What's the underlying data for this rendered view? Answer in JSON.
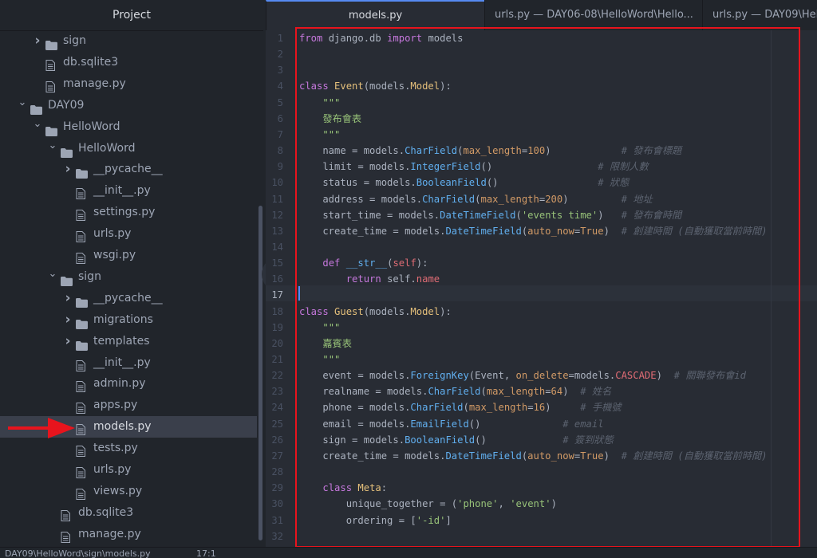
{
  "sidebar": {
    "title": "Project",
    "rows": [
      {
        "label": "sign",
        "type": "folder",
        "level": 1,
        "chevron": "right"
      },
      {
        "label": "db.sqlite3",
        "type": "file",
        "level": 1
      },
      {
        "label": "manage.py",
        "type": "file",
        "level": 1
      },
      {
        "label": "DAY09",
        "type": "folder",
        "level": 0,
        "chevron": "down"
      },
      {
        "label": "HelloWord",
        "type": "folder",
        "level": 1,
        "chevron": "down"
      },
      {
        "label": "HelloWord",
        "type": "folder",
        "level": 2,
        "chevron": "down"
      },
      {
        "label": "__pycache__",
        "type": "folder",
        "level": 3,
        "chevron": "right"
      },
      {
        "label": "__init__.py",
        "type": "file",
        "level": 3
      },
      {
        "label": "settings.py",
        "type": "file",
        "level": 3
      },
      {
        "label": "urls.py",
        "type": "file",
        "level": 3
      },
      {
        "label": "wsgi.py",
        "type": "file",
        "level": 3
      },
      {
        "label": "sign",
        "type": "folder",
        "level": 2,
        "chevron": "down"
      },
      {
        "label": "__pycache__",
        "type": "folder",
        "level": 3,
        "chevron": "right"
      },
      {
        "label": "migrations",
        "type": "folder",
        "level": 3,
        "chevron": "right"
      },
      {
        "label": "templates",
        "type": "folder",
        "level": 3,
        "chevron": "right"
      },
      {
        "label": "__init__.py",
        "type": "file",
        "level": 3
      },
      {
        "label": "admin.py",
        "type": "file",
        "level": 3
      },
      {
        "label": "apps.py",
        "type": "file",
        "level": 3
      },
      {
        "label": "models.py",
        "type": "file",
        "level": 3,
        "selected": true
      },
      {
        "label": "tests.py",
        "type": "file",
        "level": 3
      },
      {
        "label": "urls.py",
        "type": "file",
        "level": 3
      },
      {
        "label": "views.py",
        "type": "file",
        "level": 3
      },
      {
        "label": "db.sqlite3",
        "type": "file",
        "level": 2
      },
      {
        "label": "manage.py",
        "type": "file",
        "level": 2
      }
    ]
  },
  "tabs": [
    {
      "label": "models.py",
      "active": true
    },
    {
      "label": "urls.py — DAY06-08\\HelloWord\\Hello...",
      "active": false
    },
    {
      "label": "urls.py — DAY09\\HelloWord\\He",
      "active": false
    }
  ],
  "editor": {
    "cursor_line": 17,
    "lines": [
      [
        [
          "kw",
          "from"
        ],
        [
          "plain",
          " django.db "
        ],
        [
          "kw",
          "import"
        ],
        [
          "plain",
          " models"
        ]
      ],
      [],
      [],
      [
        [
          "kw",
          "class"
        ],
        [
          "plain",
          " "
        ],
        [
          "cls",
          "Event"
        ],
        [
          "plain",
          "(models."
        ],
        [
          "cls",
          "Model"
        ],
        [
          "plain",
          "):"
        ]
      ],
      [
        [
          "plain",
          "    "
        ],
        [
          "str",
          "\"\"\""
        ]
      ],
      [
        [
          "plain",
          "    "
        ],
        [
          "str",
          "發布會表"
        ]
      ],
      [
        [
          "plain",
          "    "
        ],
        [
          "str",
          "\"\"\""
        ]
      ],
      [
        [
          "plain",
          "    name = models."
        ],
        [
          "fn",
          "CharField"
        ],
        [
          "plain",
          "("
        ],
        [
          "arg",
          "max_length"
        ],
        [
          "plain",
          "="
        ],
        [
          "num",
          "100"
        ],
        [
          "plain",
          ")            "
        ],
        [
          "cmt",
          "# 發布會標題"
        ]
      ],
      [
        [
          "plain",
          "    limit = models."
        ],
        [
          "fn",
          "IntegerField"
        ],
        [
          "plain",
          "()                  "
        ],
        [
          "cmt",
          "# 限制人數"
        ]
      ],
      [
        [
          "plain",
          "    status = models."
        ],
        [
          "fn",
          "BooleanField"
        ],
        [
          "plain",
          "()                 "
        ],
        [
          "cmt",
          "# 狀態"
        ]
      ],
      [
        [
          "plain",
          "    address = models."
        ],
        [
          "fn",
          "CharField"
        ],
        [
          "plain",
          "("
        ],
        [
          "arg",
          "max_length"
        ],
        [
          "plain",
          "="
        ],
        [
          "num",
          "200"
        ],
        [
          "plain",
          ")         "
        ],
        [
          "cmt",
          "# 地址"
        ]
      ],
      [
        [
          "plain",
          "    start_time = models."
        ],
        [
          "fn",
          "DateTimeField"
        ],
        [
          "plain",
          "("
        ],
        [
          "str",
          "'events time'"
        ],
        [
          "plain",
          ")   "
        ],
        [
          "cmt",
          "# 發布會時間"
        ]
      ],
      [
        [
          "plain",
          "    create_time = models."
        ],
        [
          "fn",
          "DateTimeField"
        ],
        [
          "plain",
          "("
        ],
        [
          "arg",
          "auto_now"
        ],
        [
          "plain",
          "="
        ],
        [
          "num",
          "True"
        ],
        [
          "plain",
          ")  "
        ],
        [
          "cmt",
          "# 創建時間 (自動獲取當前時間)"
        ]
      ],
      [],
      [
        [
          "plain",
          "    "
        ],
        [
          "kw",
          "def"
        ],
        [
          "plain",
          " "
        ],
        [
          "fn",
          "__str__"
        ],
        [
          "plain",
          "("
        ],
        [
          "prop",
          "self"
        ],
        [
          "plain",
          "):"
        ]
      ],
      [
        [
          "plain",
          "        "
        ],
        [
          "kw",
          "return"
        ],
        [
          "plain",
          " self."
        ],
        [
          "prop",
          "name"
        ]
      ],
      [],
      [
        [
          "kw",
          "class"
        ],
        [
          "plain",
          " "
        ],
        [
          "cls",
          "Guest"
        ],
        [
          "plain",
          "(models."
        ],
        [
          "cls",
          "Model"
        ],
        [
          "plain",
          "):"
        ]
      ],
      [
        [
          "plain",
          "    "
        ],
        [
          "str",
          "\"\"\""
        ]
      ],
      [
        [
          "plain",
          "    "
        ],
        [
          "str",
          "嘉賓表"
        ]
      ],
      [
        [
          "plain",
          "    "
        ],
        [
          "str",
          "\"\"\""
        ]
      ],
      [
        [
          "plain",
          "    event = models."
        ],
        [
          "fn",
          "ForeignKey"
        ],
        [
          "plain",
          "(Event, "
        ],
        [
          "arg",
          "on_delete"
        ],
        [
          "plain",
          "=models."
        ],
        [
          "prop",
          "CASCADE"
        ],
        [
          "plain",
          ")  "
        ],
        [
          "cmt",
          "# 關聯發布會id"
        ]
      ],
      [
        [
          "plain",
          "    realname = models."
        ],
        [
          "fn",
          "CharField"
        ],
        [
          "plain",
          "("
        ],
        [
          "arg",
          "max_length"
        ],
        [
          "plain",
          "="
        ],
        [
          "num",
          "64"
        ],
        [
          "plain",
          ")  "
        ],
        [
          "cmt",
          "# 姓名"
        ]
      ],
      [
        [
          "plain",
          "    phone = models."
        ],
        [
          "fn",
          "CharField"
        ],
        [
          "plain",
          "("
        ],
        [
          "arg",
          "max_length"
        ],
        [
          "plain",
          "="
        ],
        [
          "num",
          "16"
        ],
        [
          "plain",
          ")     "
        ],
        [
          "cmt",
          "# 手機號"
        ]
      ],
      [
        [
          "plain",
          "    email = models."
        ],
        [
          "fn",
          "EmailField"
        ],
        [
          "plain",
          "()              "
        ],
        [
          "cmt",
          "# email"
        ]
      ],
      [
        [
          "plain",
          "    sign = models."
        ],
        [
          "fn",
          "BooleanField"
        ],
        [
          "plain",
          "()             "
        ],
        [
          "cmt",
          "# 簽到狀態"
        ]
      ],
      [
        [
          "plain",
          "    create_time = models."
        ],
        [
          "fn",
          "DateTimeField"
        ],
        [
          "plain",
          "("
        ],
        [
          "arg",
          "auto_now"
        ],
        [
          "plain",
          "="
        ],
        [
          "num",
          "True"
        ],
        [
          "plain",
          ")  "
        ],
        [
          "cmt",
          "# 創建時間 (自動獲取當前時間)"
        ]
      ],
      [],
      [
        [
          "plain",
          "    "
        ],
        [
          "kw",
          "class"
        ],
        [
          "plain",
          " "
        ],
        [
          "cls",
          "Meta"
        ],
        [
          "plain",
          ":"
        ]
      ],
      [
        [
          "plain",
          "        unique_together = ("
        ],
        [
          "str",
          "'phone'"
        ],
        [
          "plain",
          ", "
        ],
        [
          "str",
          "'event'"
        ],
        [
          "plain",
          ")"
        ]
      ],
      [
        [
          "plain",
          "        ordering = ["
        ],
        [
          "str",
          "'-id'"
        ],
        [
          "plain",
          "]"
        ]
      ],
      []
    ]
  },
  "status": {
    "path": "DAY09\\HelloWord\\sign\\models.py",
    "position": "17:1"
  },
  "colors": {
    "sidebar_bg": "#21252b",
    "editor_bg": "#282c34",
    "selection": "#3a3f4b",
    "annotation_red": "#e8141d",
    "cursor": "#528bff"
  }
}
